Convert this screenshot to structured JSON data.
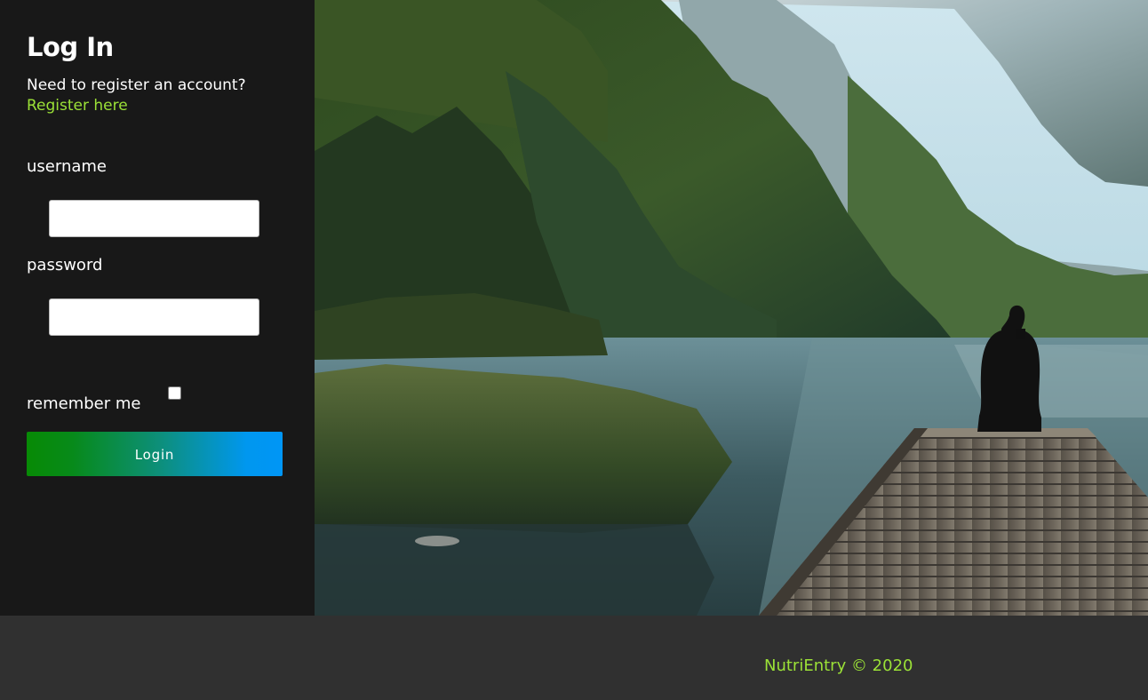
{
  "login": {
    "title": "Log In",
    "register_prompt": "Need to register an account?",
    "register_link": "Register here",
    "username_label": "username",
    "username_value": "",
    "username_placeholder": "",
    "password_label": "password",
    "password_value": "",
    "password_placeholder": "",
    "remember_label": "remember me",
    "remember_checked": false,
    "login_button": "Login"
  },
  "hero": {
    "image": "mountain-lake-dock-photo",
    "description": ""
  },
  "footer": {
    "text": "NutriEntry © 2020"
  },
  "colors": {
    "panel_background": "#181818",
    "footer_background": "#303030",
    "accent_green": "#9be137",
    "button_gradient_start": "#078a05",
    "button_gradient_end": "#0096f6"
  }
}
